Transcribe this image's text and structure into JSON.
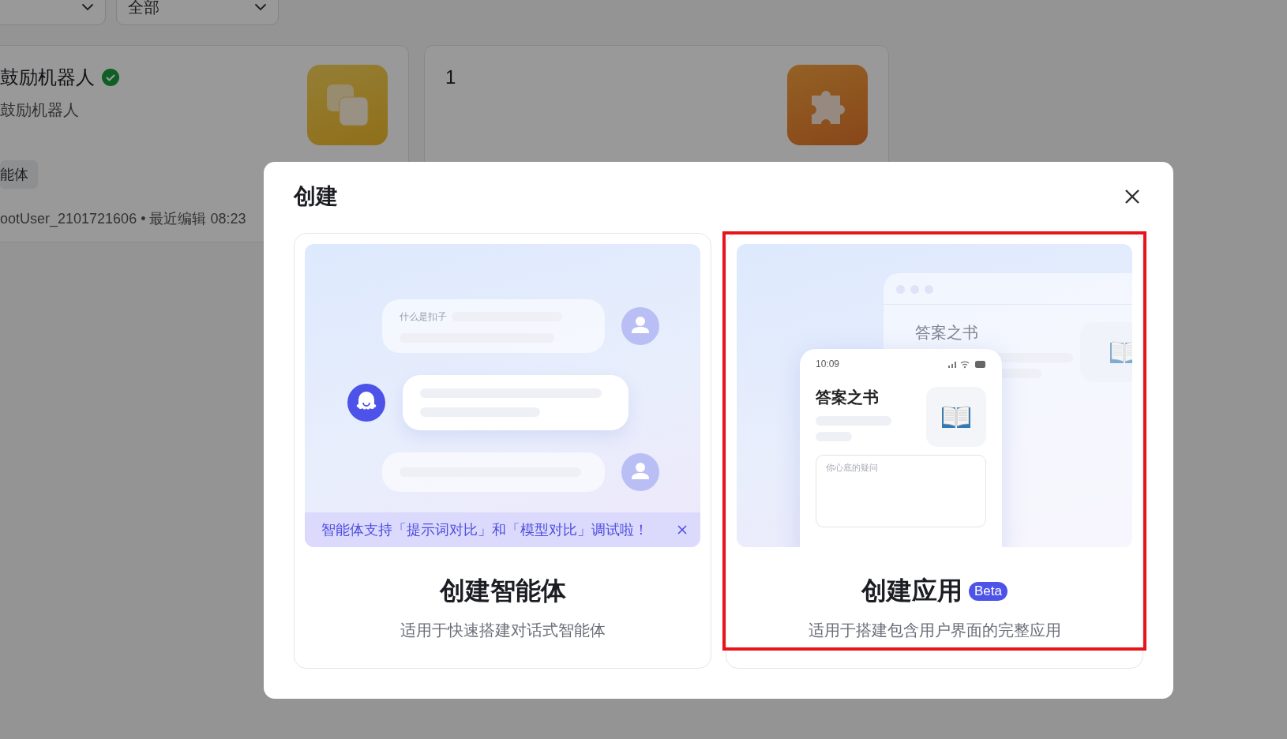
{
  "background": {
    "filter_dropdowns": [
      {
        "kind": "icon_only"
      },
      {
        "kind": "labeled",
        "label": "全部"
      }
    ],
    "cards": [
      {
        "title": "鼓励机器人",
        "verified": true,
        "description": "鼓励机器人",
        "tag": "能体",
        "meta": "ootUser_2101721606 • 最近编辑 08:23",
        "kind": "layers"
      },
      {
        "title": "1",
        "verified": false,
        "kind": "puzzle"
      }
    ]
  },
  "dialog": {
    "title": "创建",
    "options": [
      {
        "kind": "agent",
        "title": "创建智能体",
        "subtitle": "适用于快速搭建对话式智能体",
        "highlighted": false,
        "illustration": {
          "question": "什么是扣子"
        },
        "banner": "智能体支持「提示词对比」和「模型对比」调试啦！"
      },
      {
        "kind": "app",
        "title": "创建应用",
        "badge": "Beta",
        "subtitle": "适用于搭建包含用户界面的完整应用",
        "highlighted": true,
        "illustration": {
          "window_title": "答案之书",
          "time": "10:09",
          "app_title": "答案之书",
          "input_placeholder": "你心底的疑问"
        }
      }
    ]
  }
}
